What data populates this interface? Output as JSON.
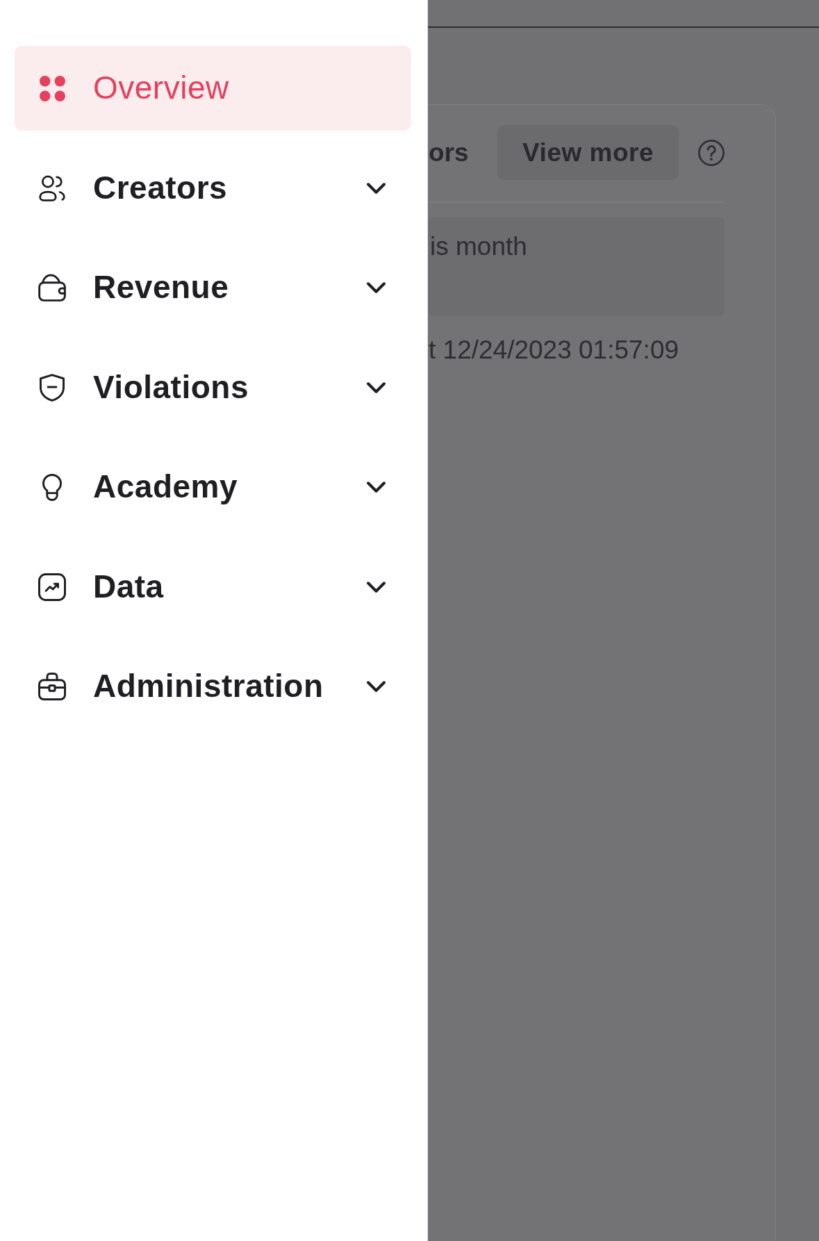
{
  "drawer": {
    "items": [
      {
        "label": "Overview",
        "kind": "link",
        "selected": true
      },
      {
        "label": "Creators",
        "kind": "group",
        "selected": false,
        "expanded": false
      },
      {
        "label": "Revenue",
        "kind": "group",
        "selected": false,
        "expanded": false
      },
      {
        "label": "Violations",
        "kind": "group",
        "selected": false,
        "expanded": false
      },
      {
        "label": "Academy",
        "kind": "group",
        "selected": false,
        "expanded": false
      },
      {
        "label": "Data",
        "kind": "group",
        "selected": false,
        "expanded": false
      },
      {
        "label": "Administration",
        "kind": "group",
        "selected": false,
        "expanded": false
      }
    ]
  },
  "page": {
    "card": {
      "title": "ors",
      "button": "View more",
      "period": "is month",
      "updated": "t 12/24/2023 01:57:09"
    }
  }
}
